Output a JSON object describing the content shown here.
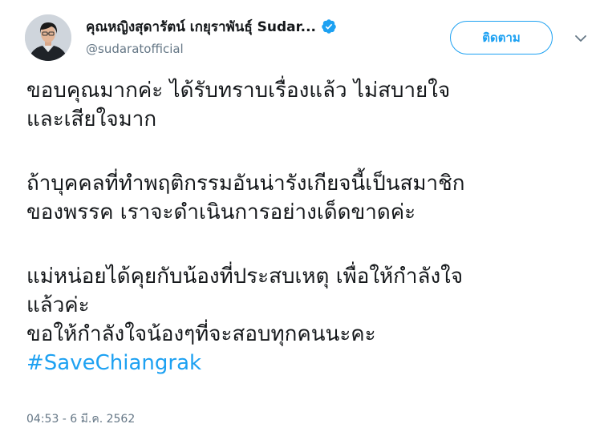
{
  "author": {
    "display_name": "คุณหญิงสุดารัตน์ เกยุราพันธุ์ Sudar...",
    "handle": "@sudaratofficial",
    "verified": true,
    "avatar_icon": "profile-photo"
  },
  "actions": {
    "follow_label": "ติดตาม",
    "more_icon": "chevron-down-icon"
  },
  "tweet": {
    "paragraphs": [
      [
        "ขอบคุณมากค่ะ  ได้รับทราบเรื่องแล้ว ไม่สบายใจ",
        "และเสียใจมาก"
      ],
      [
        "ถ้าบุคคลที่ทำพฤติกรรมอันน่ารังเกียจนี้เป็นสมาชิก",
        "ของพรรค เราจะดำเนินการอย่างเด็ดขาดค่ะ"
      ],
      [
        "แม่หน่อยได้คุยกับน้องที่ประสบเหตุ เพื่อให้กำลังใจ",
        "แล้วค่ะ",
        "ขอให้กำลังใจน้องๆที่จะสอบทุกคนนะคะ"
      ]
    ],
    "hashtag": "#SaveChiangrak",
    "timestamp": "04:53 - 6 มี.ค. 2562"
  },
  "colors": {
    "accent": "#1da1f2",
    "text": "#14171a",
    "secondary": "#657786"
  }
}
